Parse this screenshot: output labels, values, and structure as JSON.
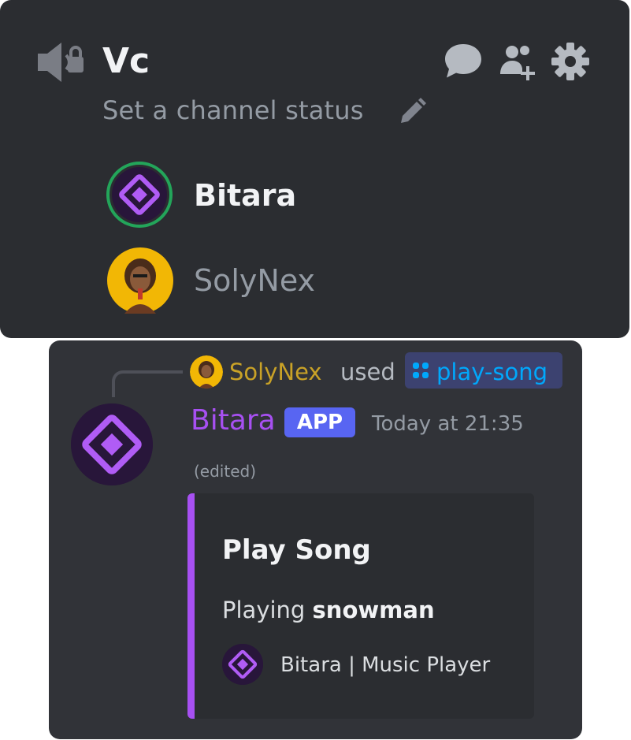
{
  "voice_channel": {
    "name": "Vc",
    "status_placeholder": "Set a channel status",
    "members": [
      {
        "name": "Bitara",
        "speaking": true
      },
      {
        "name": "SolyNex",
        "speaking": false
      }
    ]
  },
  "message": {
    "reply": {
      "user": "SolyNex",
      "verb": "used",
      "command": "play-song"
    },
    "author": "Bitara",
    "badge": "APP",
    "timestamp": "Today at 21:35",
    "edited": "(edited)",
    "embed": {
      "title": "Play Song",
      "desc_prefix": "Playing ",
      "desc_bold": "snowman",
      "footer": "Bitara | Music Player"
    }
  },
  "colors": {
    "bot_purple": "#a750f2",
    "app_badge": "#5865f2",
    "speaking_ring": "#23a55a",
    "command_link": "#00a8fc",
    "reply_username": "#c9a227"
  },
  "icons": [
    "speaker-lock-icon",
    "chat-bubble-icon",
    "add-user-icon",
    "gear-icon",
    "pencil-icon",
    "slash-command-icon"
  ]
}
